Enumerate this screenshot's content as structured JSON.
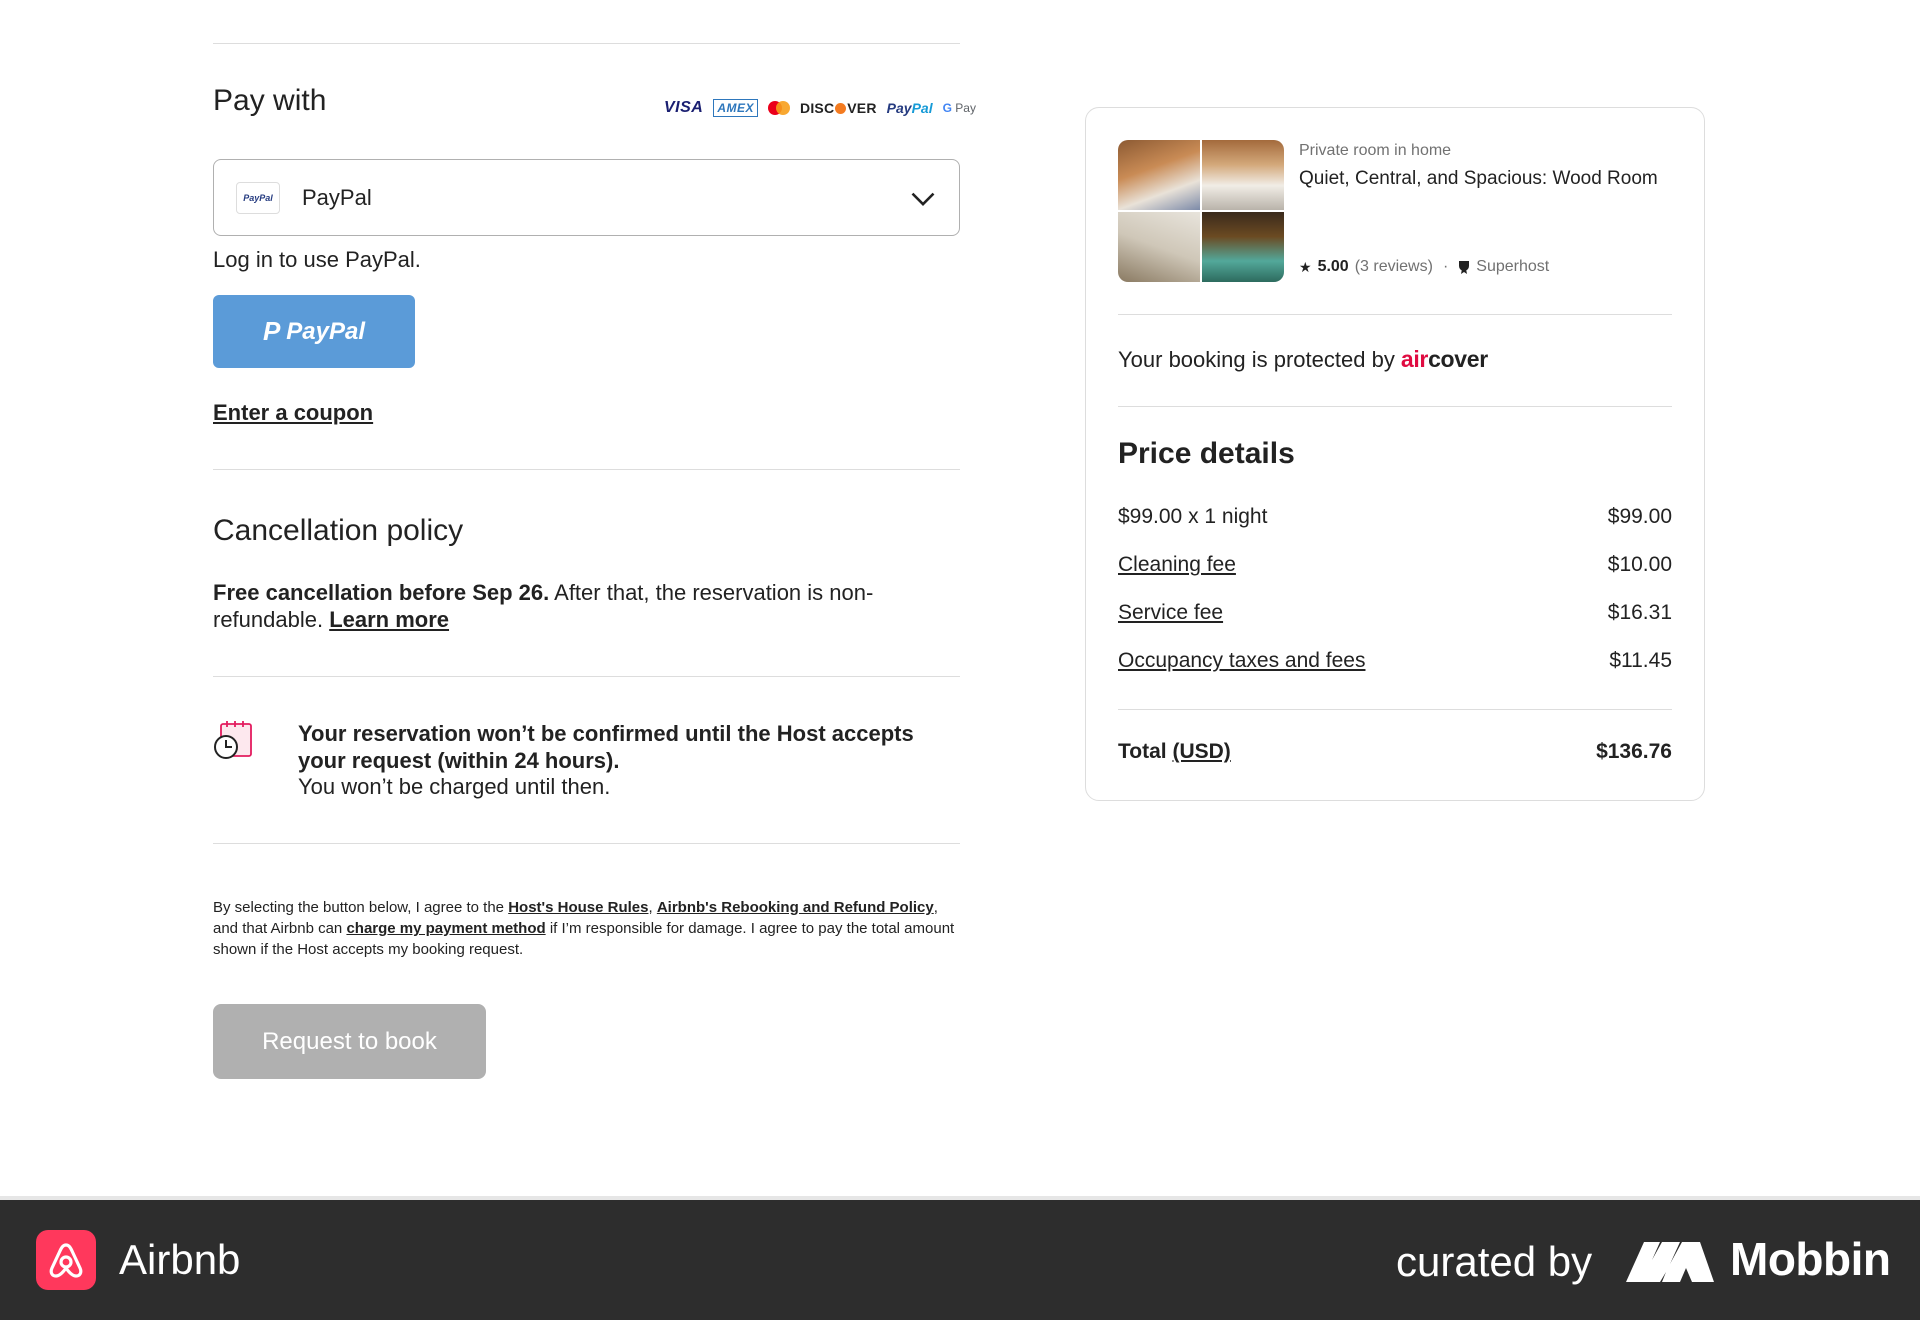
{
  "payment": {
    "title": "Pay with",
    "card_logos": {
      "visa": "VISA",
      "amex": "AMEX",
      "discover_pre": "DISC",
      "discover_post": "VER",
      "paypal_a": "Pay",
      "paypal_b": "Pal",
      "gpay_g": "G",
      "gpay_pay": "Pay"
    },
    "method_icon_text": "PayPal",
    "selected_method": "PayPal",
    "login_text": "Log in to use PayPal.",
    "paypal_button_mark": "P",
    "paypal_button_label": "PayPal",
    "coupon_label": "Enter a coupon"
  },
  "cancellation": {
    "title": "Cancellation policy",
    "bold_text": "Free cancellation before Sep 26.",
    "text": " After that, the reservation is non-refundable. ",
    "learn_more": "Learn more"
  },
  "notice": {
    "title": "Your reservation won’t be confirmed until the Host accepts your request (within 24 hours).",
    "subtitle": "You won’t be charged until then."
  },
  "legal": {
    "p1": "By selecting the button below, I agree to the ",
    "link1": "Host's House Rules",
    "p2": ", ",
    "link2": "Airbnb's Rebooking and Refund Policy",
    "p3": ", and that Airbnb can ",
    "link3": "charge my payment method",
    "p4": " if I’m responsible for damage. I agree to pay the total amount shown if the Host accepts my booking request."
  },
  "request_button": "Request to book",
  "listing": {
    "type": "Private room in home",
    "name": "Quiet, Central, and Spacious: Wood Room",
    "rating": "5.00",
    "reviews": "(3 reviews)",
    "superhost": "Superhost",
    "protected_text": "Your booking is protected by",
    "aircover_air": "air",
    "aircover_cover": "cover"
  },
  "price_details": {
    "title": "Price details",
    "rows": [
      {
        "label": "$99.00 x 1 night",
        "amount": "$99.00"
      },
      {
        "label": "Cleaning fee",
        "amount": "$10.00"
      },
      {
        "label": "Service fee",
        "amount": "$16.31"
      },
      {
        "label": "Occupancy taxes and fees",
        "amount": "$11.45"
      }
    ],
    "total_label": "Total",
    "currency": "(USD)",
    "total_amount": "$136.76"
  },
  "footer": {
    "app_name": "Airbnb",
    "curated_by": "curated by",
    "brand": "Mobbin"
  },
  "colors": {
    "brand": "#ff385c",
    "aircover_red": "#e00b41",
    "paypal_button": "#5b9bd8",
    "disabled_button": "#b0b0b0",
    "footer_bg": "#2d2d2d"
  }
}
